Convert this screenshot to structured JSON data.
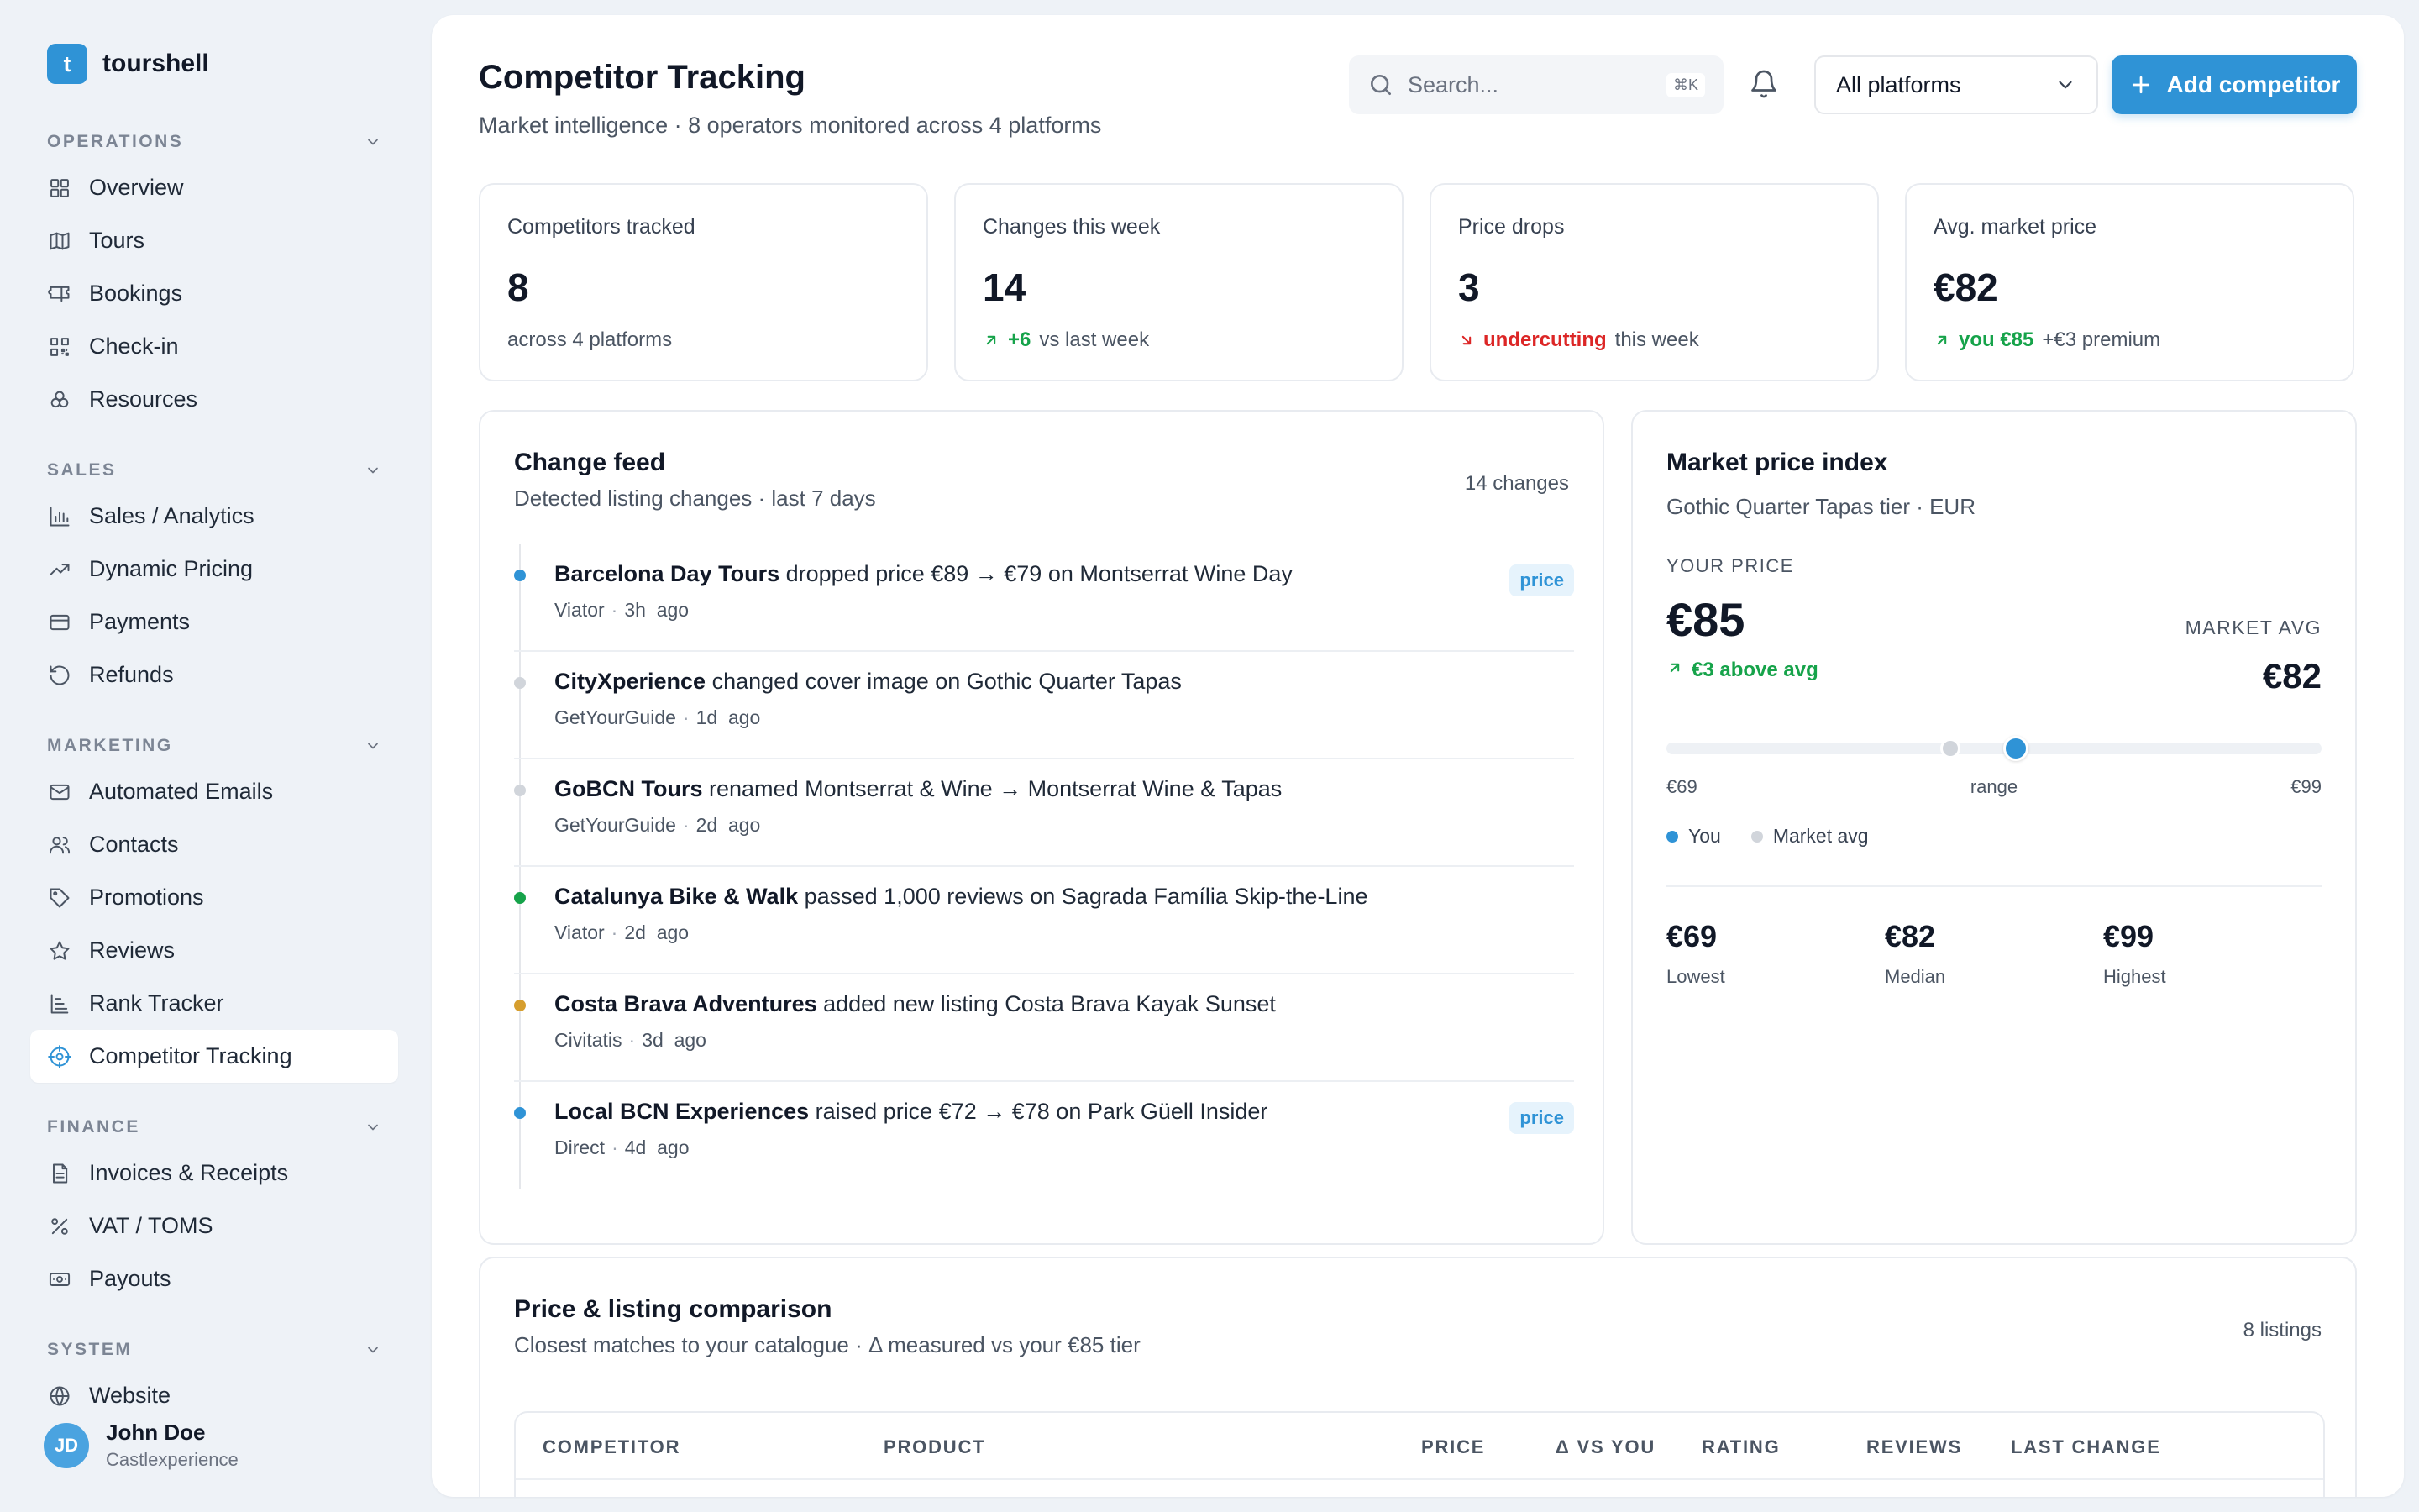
{
  "brand": {
    "logo_letter": "t",
    "name": "tourshell"
  },
  "sidebar": {
    "sections": [
      {
        "title": "OPERATIONS",
        "items": [
          {
            "label": "Overview",
            "icon": "grid-icon"
          },
          {
            "label": "Tours",
            "icon": "map-icon"
          },
          {
            "label": "Bookings",
            "icon": "ticket-icon"
          },
          {
            "label": "Check-in",
            "icon": "qr-icon"
          },
          {
            "label": "Resources",
            "icon": "boxes-icon"
          }
        ]
      },
      {
        "title": "SALES",
        "items": [
          {
            "label": "Sales / Analytics",
            "icon": "bar-chart-icon"
          },
          {
            "label": "Dynamic Pricing",
            "icon": "trend-icon"
          },
          {
            "label": "Payments",
            "icon": "card-icon"
          },
          {
            "label": "Refunds",
            "icon": "undo-icon"
          }
        ]
      },
      {
        "title": "MARKETING",
        "items": [
          {
            "label": "Automated Emails",
            "icon": "mail-icon"
          },
          {
            "label": "Contacts",
            "icon": "users-icon"
          },
          {
            "label": "Promotions",
            "icon": "tag-icon"
          },
          {
            "label": "Reviews",
            "icon": "star-icon"
          },
          {
            "label": "Rank Tracker",
            "icon": "rank-icon"
          },
          {
            "label": "Competitor Tracking",
            "icon": "target-icon",
            "active": true
          }
        ]
      },
      {
        "title": "FINANCE",
        "items": [
          {
            "label": "Invoices & Receipts",
            "icon": "document-icon"
          },
          {
            "label": "VAT / TOMS",
            "icon": "percent-icon"
          },
          {
            "label": "Payouts",
            "icon": "banknote-icon"
          }
        ]
      },
      {
        "title": "SYSTEM",
        "items": [
          {
            "label": "Website",
            "icon": "globe-icon"
          }
        ]
      }
    ]
  },
  "user": {
    "initials": "JD",
    "name": "John Doe",
    "org": "Castlexperience"
  },
  "header": {
    "title": "Competitor Tracking",
    "subtitle": "Market intelligence · 8 operators monitored across 4 platforms",
    "search_placeholder": "Search...",
    "search_shortcut": "⌘K",
    "platform_select": "All platforms",
    "add_button": "Add competitor"
  },
  "stats": [
    {
      "label": "Competitors tracked",
      "value": "8",
      "foot_highlight": "",
      "foot_text": "across 4 platforms",
      "trend": "none"
    },
    {
      "label": "Changes this week",
      "value": "14",
      "foot_highlight": "+6",
      "foot_text": "vs last week",
      "trend": "up"
    },
    {
      "label": "Price drops",
      "value": "3",
      "foot_highlight": "undercutting",
      "foot_text": "this week",
      "trend": "down"
    },
    {
      "label": "Avg. market price",
      "value": "€82",
      "foot_highlight": "you €85",
      "foot_text": "+€3 premium",
      "trend": "up"
    }
  ],
  "feed": {
    "title": "Change feed",
    "subtitle": "Detected listing changes · last 7 days",
    "count": "14 changes",
    "items": [
      {
        "operator": "Barcelona Day Tours",
        "text": "dropped price €89 → €79 on Montserrat Wine Day",
        "platform": "Viator",
        "time": "3h",
        "ago": "ago",
        "dot": "#2f93d6",
        "tag": "price"
      },
      {
        "operator": "CityXperience",
        "text": "changed cover image on Gothic Quarter Tapas",
        "platform": "GetYourGuide",
        "time": "1d",
        "ago": "ago",
        "dot": "#d1d5db",
        "tag": ""
      },
      {
        "operator": "GoBCN Tours",
        "text": "renamed Montserrat & Wine → Montserrat Wine & Tapas",
        "platform": "GetYourGuide",
        "time": "2d",
        "ago": "ago",
        "dot": "#d1d5db",
        "tag": ""
      },
      {
        "operator": "Catalunya Bike & Walk",
        "text": "passed 1,000 reviews on Sagrada Família Skip-the-Line",
        "platform": "Viator",
        "time": "2d",
        "ago": "ago",
        "dot": "#16a34a",
        "tag": ""
      },
      {
        "operator": "Costa Brava Adventures",
        "text": "added new listing Costa Brava Kayak Sunset",
        "platform": "Civitatis",
        "time": "3d",
        "ago": "ago",
        "dot": "#d69e2e",
        "tag": ""
      },
      {
        "operator": "Local BCN Experiences",
        "text": "raised price €72 → €78 on Park Güell Insider",
        "platform": "Direct",
        "time": "4d",
        "ago": "ago",
        "dot": "#2f93d6",
        "tag": "price"
      }
    ]
  },
  "market": {
    "title": "Market price index",
    "subtitle": "Gothic Quarter Tapas tier · EUR",
    "your_label": "YOUR PRICE",
    "your_value": "€85",
    "your_delta": "€3 above avg",
    "avg_label": "MARKET AVG",
    "avg_value": "€82",
    "range_min": 69,
    "range_max": 99,
    "you_price": 85,
    "avg_price": 82,
    "range_min_label": "€69",
    "range_label": "range",
    "range_max_label": "€99",
    "legend_you": "You",
    "legend_avg": "Market avg",
    "summary": [
      {
        "value": "€69",
        "label": "Lowest"
      },
      {
        "value": "€82",
        "label": "Median"
      },
      {
        "value": "€99",
        "label": "Highest"
      }
    ]
  },
  "comparison": {
    "title": "Price & listing comparison",
    "subtitle": "Closest matches to your catalogue · Δ measured vs your €85 tier",
    "count": "8 listings",
    "columns": [
      "COMPETITOR",
      "PRODUCT",
      "PRICE",
      "Δ VS YOU",
      "RATING",
      "REVIEWS",
      "LAST CHANGE"
    ]
  },
  "colors": {
    "accent": "#2f93d6",
    "up": "#16a34a",
    "down": "#dc2626"
  }
}
